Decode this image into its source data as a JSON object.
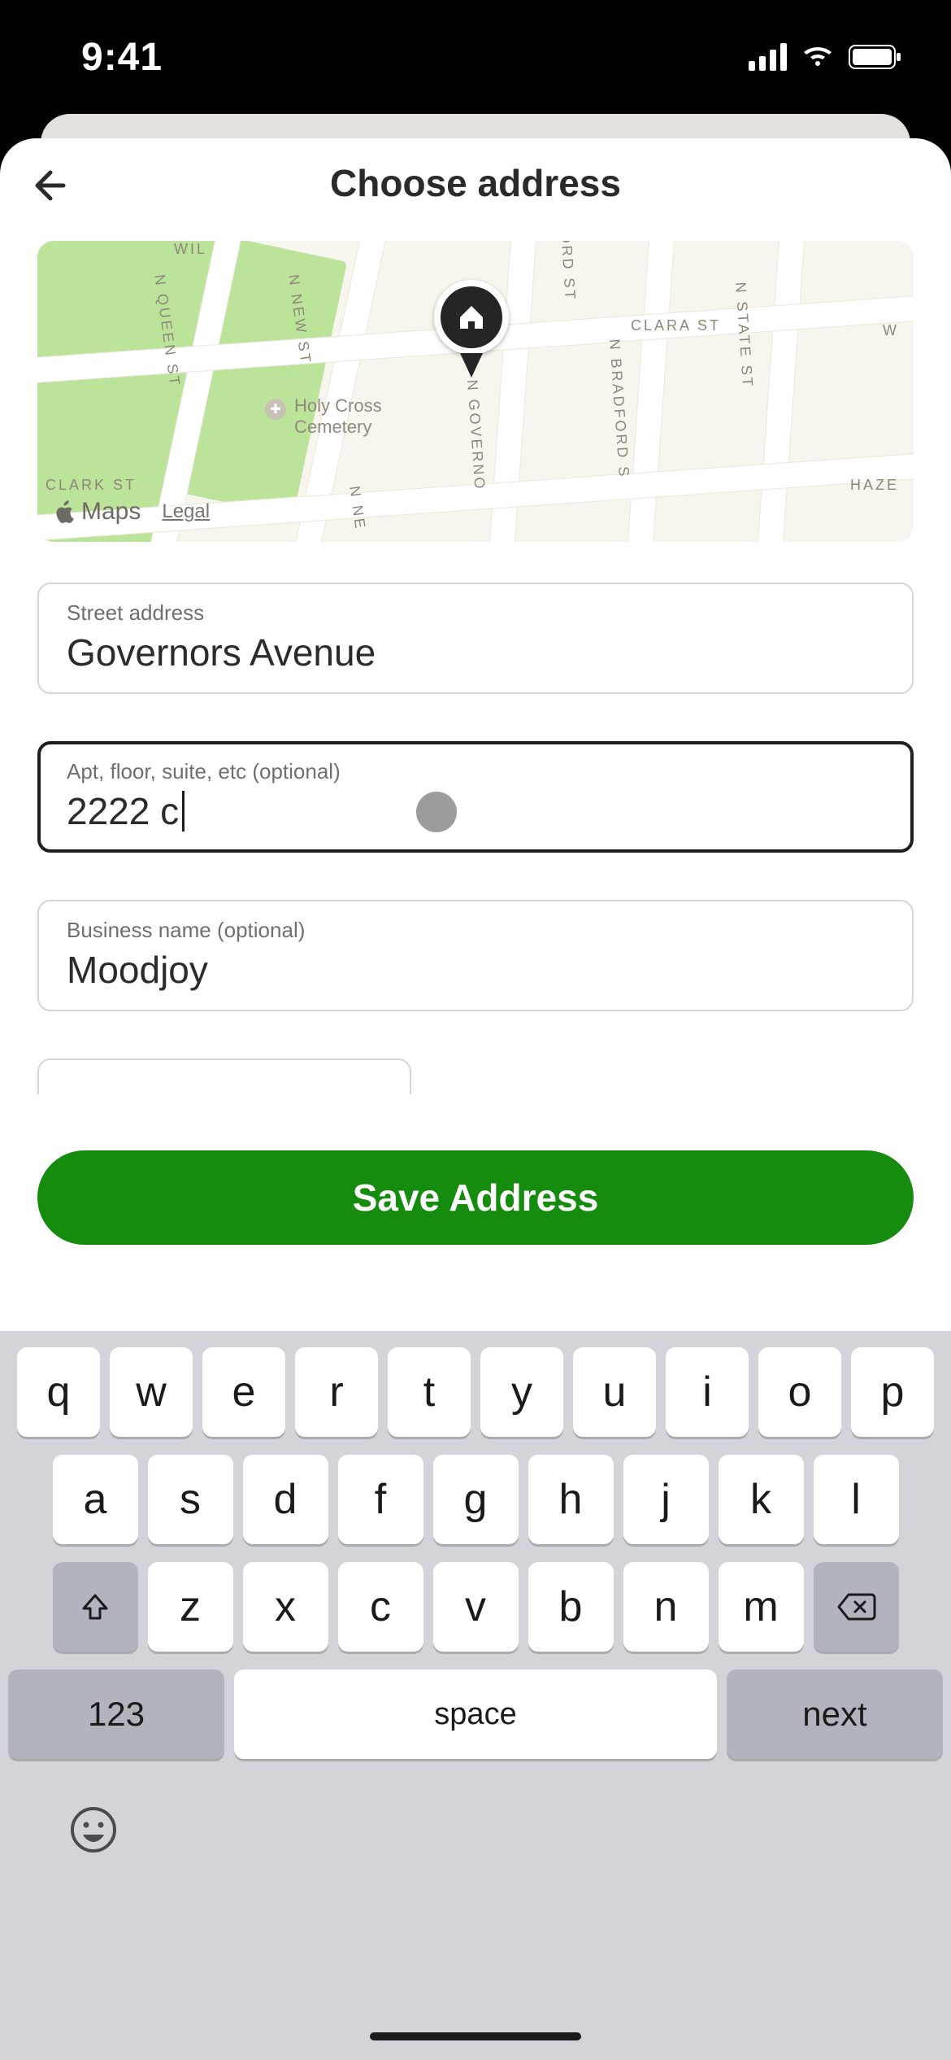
{
  "statusbar": {
    "time": "9:41"
  },
  "header": {
    "title": "Choose address"
  },
  "map": {
    "brand": "Maps",
    "legal": "Legal",
    "poi_label": "Holy Cross\nCemetery",
    "streets": {
      "new": "N NEW ST",
      "queen": "N QUEEN ST",
      "governor": "N GOVERNO",
      "bradford": "N BRADFORD S",
      "state": "N STATE ST",
      "clara": "CLARA ST",
      "haze": "HAZE",
      "ord": "ORD ST",
      "clark": "CLARK ST",
      "wil": "WIL",
      "w": "W",
      "nne": "N NE"
    }
  },
  "fields": {
    "street": {
      "label": "Street address",
      "value": "Governors Avenue"
    },
    "apt": {
      "label": "Apt, floor, suite, etc (optional)",
      "value": "2222 c"
    },
    "biz": {
      "label": "Business name (optional)",
      "value": "Moodjoy"
    }
  },
  "save_label": "Save Address",
  "keyboard": {
    "row1": [
      "q",
      "w",
      "e",
      "r",
      "t",
      "y",
      "u",
      "i",
      "o",
      "p"
    ],
    "row2": [
      "a",
      "s",
      "d",
      "f",
      "g",
      "h",
      "j",
      "k",
      "l"
    ],
    "row3": [
      "z",
      "x",
      "c",
      "v",
      "b",
      "n",
      "m"
    ],
    "k123": "123",
    "space": "space",
    "next": "next"
  }
}
